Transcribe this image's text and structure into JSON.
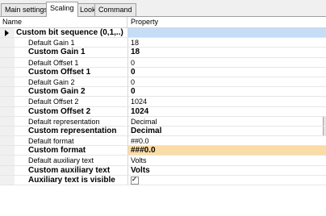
{
  "tabs": [
    {
      "label": "Main settings"
    },
    {
      "label": "Scaling"
    },
    {
      "label": "Look"
    },
    {
      "label": "Command"
    }
  ],
  "columns": {
    "name": "Name",
    "property": "Property"
  },
  "rows": [
    {
      "name": "Custom bit sequence  (0,1,..)",
      "value": "",
      "style": "header"
    },
    {
      "name": "Default Gain 1",
      "value": "18"
    },
    {
      "name": "Custom Gain 1",
      "value": "18",
      "style": "bold"
    },
    {
      "name": "Default Offset 1",
      "value": "0"
    },
    {
      "name": "Custom Offset 1",
      "value": "0",
      "style": "bold"
    },
    {
      "name": "Default Gain 2",
      "value": "0"
    },
    {
      "name": "Custom Gain 2",
      "value": "0",
      "style": "bold"
    },
    {
      "name": "Default Offset 2",
      "value": "1024"
    },
    {
      "name": "Custom Offset 2",
      "value": "1024",
      "style": "bold"
    },
    {
      "name": "Default representation",
      "value": "Decimal",
      "dropdown": true
    },
    {
      "name": "Custom representation",
      "value": "Decimal",
      "style": "bold",
      "dropdown": true
    },
    {
      "name": "Default format",
      "value": "##0.0"
    },
    {
      "name": "Custom format",
      "value": "###0.0",
      "style": "bold",
      "highlight": true
    },
    {
      "name": "Default auxiliary text",
      "value": "Volts"
    },
    {
      "name": "Custom auxiliary text",
      "value": "Volts",
      "style": "bold"
    },
    {
      "name": "Auxiliary text is visible",
      "value": "",
      "style": "bold",
      "checkbox": true,
      "checked": true
    }
  ],
  "colors": {
    "selected": "#c5ddf6",
    "highlight": "#fcdca5"
  }
}
